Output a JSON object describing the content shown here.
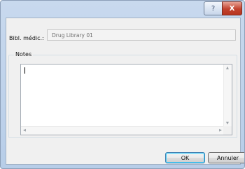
{
  "titlebar": {
    "help_label": "?",
    "close_label": "X"
  },
  "form": {
    "library_label": "Bibl. médic.:",
    "library_value": "Drug Library 01",
    "notes_label": "Notes",
    "notes_value": ""
  },
  "buttons": {
    "ok_label": "OK",
    "cancel_label": "Annuler"
  },
  "icons": {
    "help": "question-icon",
    "close": "close-icon",
    "scroll_up": "arrow-up-icon",
    "scroll_down": "arrow-down-icon",
    "scroll_left": "arrow-left-icon",
    "scroll_right": "arrow-right-icon"
  }
}
